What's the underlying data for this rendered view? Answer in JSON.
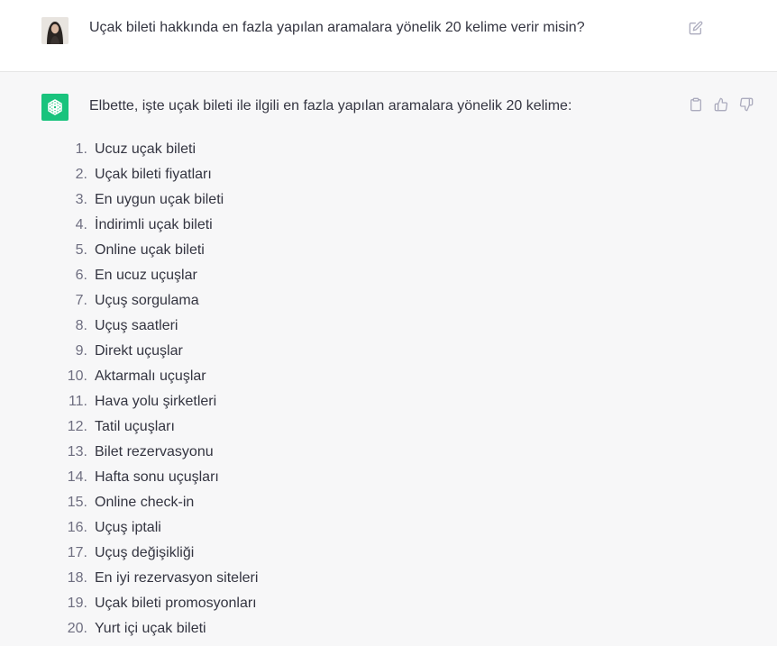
{
  "user_message": {
    "text": "Uçak bileti hakkında en fazla yapılan aramalara yönelik 20 kelime verir misin?",
    "avatar_icon": "user-avatar-photo",
    "edit_icon": "edit-icon"
  },
  "assistant_message": {
    "intro": "Elbette, işte uçak bileti ile ilgili en fazla yapılan aramalara yönelik 20 kelime:",
    "avatar_icon": "openai-logo",
    "brand_color": "#19c37d",
    "list": [
      {
        "num": "1.",
        "label": "Ucuz uçak bileti"
      },
      {
        "num": "2.",
        "label": "Uçak bileti fiyatları"
      },
      {
        "num": "3.",
        "label": "En uygun uçak bileti"
      },
      {
        "num": "4.",
        "label": "İndirimli uçak bileti"
      },
      {
        "num": "5.",
        "label": "Online uçak bileti"
      },
      {
        "num": "6.",
        "label": "En ucuz uçuşlar"
      },
      {
        "num": "7.",
        "label": "Uçuş sorgulama"
      },
      {
        "num": "8.",
        "label": "Uçuş saatleri"
      },
      {
        "num": "9.",
        "label": "Direkt uçuşlar"
      },
      {
        "num": "10.",
        "label": "Aktarmalı uçuşlar"
      },
      {
        "num": "11.",
        "label": "Hava yolu şirketleri"
      },
      {
        "num": "12.",
        "label": "Tatil uçuşları"
      },
      {
        "num": "13.",
        "label": "Bilet rezervasyonu"
      },
      {
        "num": "14.",
        "label": "Hafta sonu uçuşları"
      },
      {
        "num": "15.",
        "label": "Online check-in"
      },
      {
        "num": "16.",
        "label": "Uçuş iptali"
      },
      {
        "num": "17.",
        "label": "Uçuş değişikliği"
      },
      {
        "num": "18.",
        "label": "En iyi rezervasyon siteleri"
      },
      {
        "num": "19.",
        "label": "Uçak bileti promosyonları"
      },
      {
        "num": "20.",
        "label": "Yurt içi uçak bileti"
      }
    ],
    "actions": [
      "clipboard-icon",
      "thumbs-up-icon",
      "thumbs-down-icon"
    ]
  }
}
